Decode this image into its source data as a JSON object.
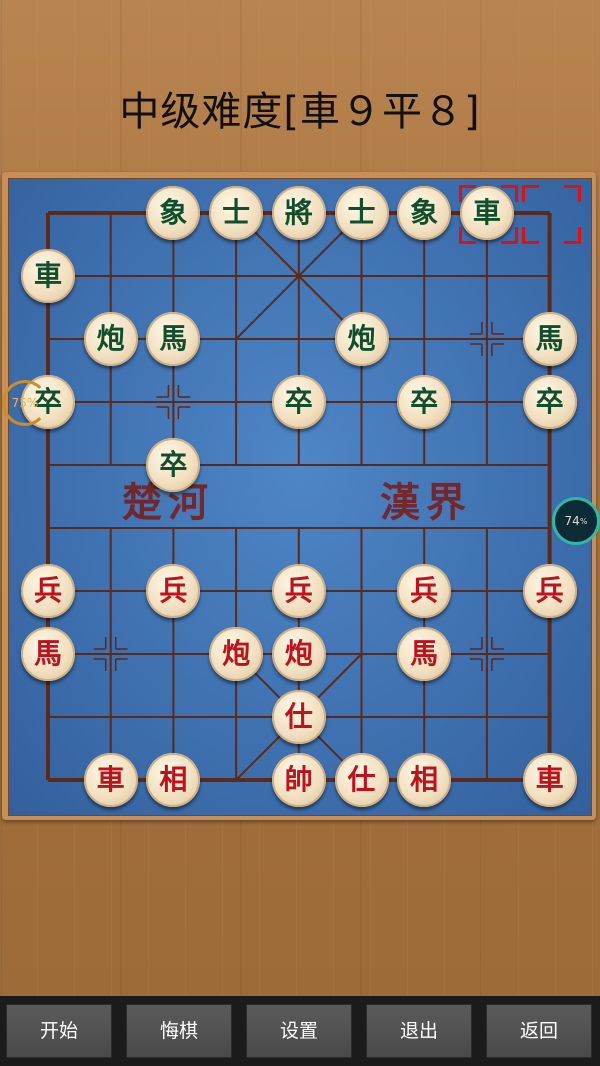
{
  "title": "中级难度[車９平８]",
  "river": {
    "left": "楚河",
    "right": "漢界"
  },
  "gauges": {
    "left": "75%",
    "right_value": "74",
    "right_unit": "%"
  },
  "toolbar": [
    "开始",
    "悔棋",
    "设置",
    "退出",
    "返回"
  ],
  "colors": {
    "red": "#c0111d",
    "black": "#114f2c",
    "board": "#3e6fae"
  },
  "pieces": [
    {
      "char": "象",
      "side": "black",
      "file": 2,
      "rank": 0
    },
    {
      "char": "士",
      "side": "black",
      "file": 3,
      "rank": 0
    },
    {
      "char": "將",
      "side": "black",
      "file": 4,
      "rank": 0
    },
    {
      "char": "士",
      "side": "black",
      "file": 5,
      "rank": 0
    },
    {
      "char": "象",
      "side": "black",
      "file": 6,
      "rank": 0
    },
    {
      "char": "車",
      "side": "black",
      "file": 7,
      "rank": 0
    },
    {
      "char": "車",
      "side": "black",
      "file": 0,
      "rank": 1
    },
    {
      "char": "炮",
      "side": "black",
      "file": 1,
      "rank": 2
    },
    {
      "char": "馬",
      "side": "black",
      "file": 2,
      "rank": 2
    },
    {
      "char": "炮",
      "side": "black",
      "file": 5,
      "rank": 2
    },
    {
      "char": "馬",
      "side": "black",
      "file": 8,
      "rank": 2
    },
    {
      "char": "卒",
      "side": "black",
      "file": 0,
      "rank": 3
    },
    {
      "char": "卒",
      "side": "black",
      "file": 4,
      "rank": 3
    },
    {
      "char": "卒",
      "side": "black",
      "file": 6,
      "rank": 3
    },
    {
      "char": "卒",
      "side": "black",
      "file": 8,
      "rank": 3
    },
    {
      "char": "卒",
      "side": "black",
      "file": 2,
      "rank": 4
    },
    {
      "char": "兵",
      "side": "red",
      "file": 0,
      "rank": 6
    },
    {
      "char": "兵",
      "side": "red",
      "file": 2,
      "rank": 6
    },
    {
      "char": "兵",
      "side": "red",
      "file": 4,
      "rank": 6
    },
    {
      "char": "兵",
      "side": "red",
      "file": 6,
      "rank": 6
    },
    {
      "char": "兵",
      "side": "red",
      "file": 8,
      "rank": 6
    },
    {
      "char": "馬",
      "side": "red",
      "file": 0,
      "rank": 7
    },
    {
      "char": "炮",
      "side": "red",
      "file": 3,
      "rank": 7
    },
    {
      "char": "炮",
      "side": "red",
      "file": 4,
      "rank": 7
    },
    {
      "char": "馬",
      "side": "red",
      "file": 6,
      "rank": 7
    },
    {
      "char": "仕",
      "side": "red",
      "file": 4,
      "rank": 8
    },
    {
      "char": "車",
      "side": "red",
      "file": 1,
      "rank": 9
    },
    {
      "char": "相",
      "side": "red",
      "file": 2,
      "rank": 9
    },
    {
      "char": "帥",
      "side": "red",
      "file": 4,
      "rank": 9
    },
    {
      "char": "仕",
      "side": "red",
      "file": 5,
      "rank": 9
    },
    {
      "char": "相",
      "side": "red",
      "file": 6,
      "rank": 9
    },
    {
      "char": "車",
      "side": "red",
      "file": 8,
      "rank": 9
    }
  ],
  "last_move": {
    "from": {
      "file": 8,
      "rank": 0
    },
    "to": {
      "file": 7,
      "rank": 0
    }
  }
}
